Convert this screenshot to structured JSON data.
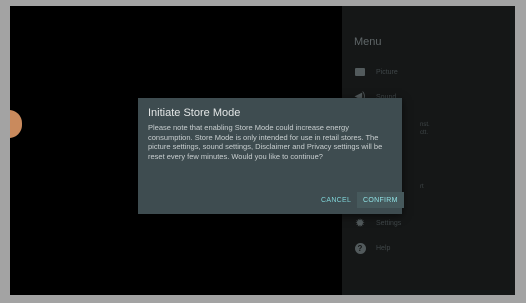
{
  "menu": {
    "title": "Menu",
    "items": [
      {
        "label": "Picture",
        "icon": "picture-icon"
      },
      {
        "label": "Sound",
        "icon": "sound-icon"
      },
      {
        "label": "Settings",
        "icon": "gear-icon"
      },
      {
        "label": "Help",
        "icon": "help-icon"
      }
    ],
    "fragments": [
      "nst.",
      "ctt.",
      "rt"
    ]
  },
  "dialog": {
    "title": "Initiate Store Mode",
    "body": "Please note that enabling Store Mode could increase energy consumption. Store Mode is only intended for use in retail stores. The picture settings, sound settings, Disclaimer and Privacy settings will be reset every few minutes. Would you like to continue?",
    "cancel_label": "CANCEL",
    "confirm_label": "CONFIRM"
  },
  "colors": {
    "accent": "#7fd3d6",
    "dialog_bg": "#3e4c50",
    "menu_bg": "#151717"
  }
}
